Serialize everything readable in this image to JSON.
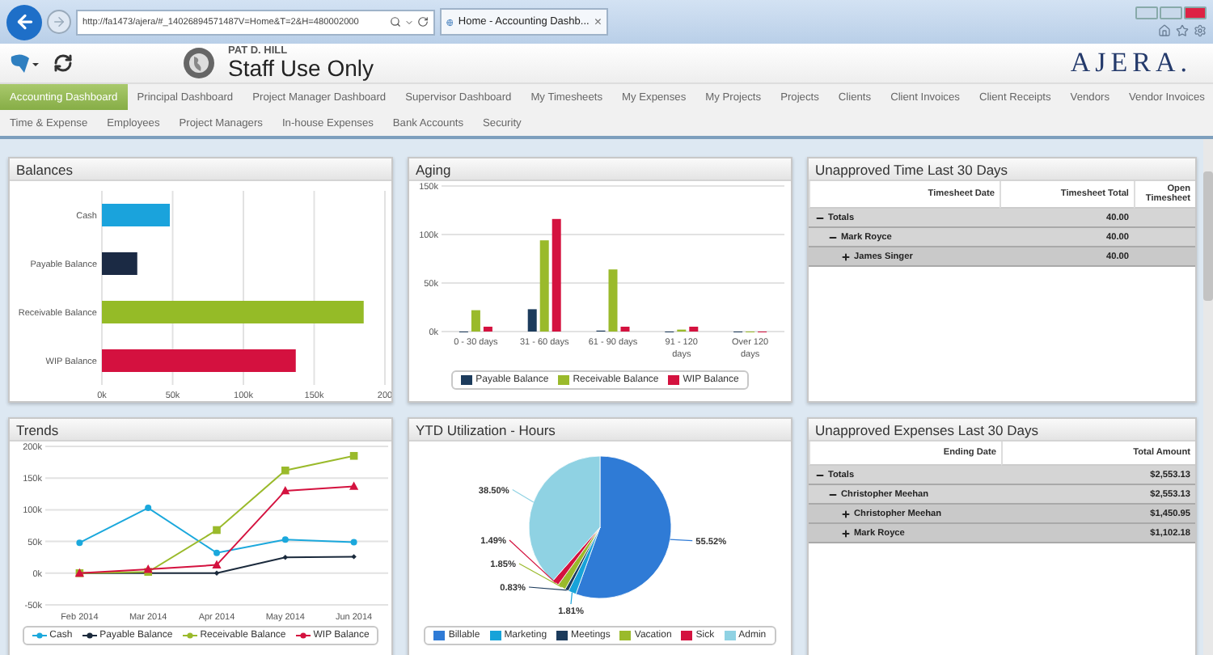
{
  "browser": {
    "address": "http://fa1473/ajera/#_14026894571487V=Home&T=2&H=480002000",
    "tab_title": "Home - Accounting Dashb...",
    "tab_close": "×"
  },
  "header": {
    "user": "PAT D. HILL",
    "title": "Staff Use Only",
    "brand": "AJERA."
  },
  "nav": [
    {
      "items": [
        {
          "label": "Accounting Dashboard",
          "selected": true
        },
        {
          "label": "Principal Dashboard",
          "selected": false
        },
        {
          "label": "Project Manager Dashboard",
          "selected": false
        },
        {
          "label": "Supervisor Dashboard",
          "selected": false
        },
        {
          "label": "My Timesheets",
          "selected": false
        },
        {
          "label": "My Expenses",
          "selected": false
        },
        {
          "label": "My Projects",
          "selected": false
        },
        {
          "label": "Projects",
          "selected": false
        },
        {
          "label": "Clients",
          "selected": false
        },
        {
          "label": "Client Invoices",
          "selected": false
        },
        {
          "label": "Client Receipts",
          "selected": false
        },
        {
          "label": "Vendors",
          "selected": false
        },
        {
          "label": "Vendor Invoices",
          "selected": false
        }
      ]
    },
    {
      "items": [
        {
          "label": "Time & Expense",
          "selected": false
        },
        {
          "label": "Employees",
          "selected": false
        },
        {
          "label": "Project Managers",
          "selected": false
        },
        {
          "label": "In-house Expenses",
          "selected": false
        },
        {
          "label": "Bank Accounts",
          "selected": false
        },
        {
          "label": "Security",
          "selected": false
        }
      ]
    }
  ],
  "balances": {
    "title": "Balances",
    "chart_data": {
      "type": "bar",
      "orientation": "horizontal",
      "categories": [
        "Cash",
        "Payable Balance",
        "Receivable Balance",
        "WIP Balance"
      ],
      "values": [
        48,
        25,
        185,
        137
      ],
      "colors": [
        "#1aa3dc",
        "#1b2a44",
        "#95bb27",
        "#d4113f"
      ],
      "grid": true,
      "xlim": [
        0,
        200
      ],
      "xticks": [
        {
          "value": 0,
          "label": "0k"
        },
        {
          "value": 50,
          "label": "50k"
        },
        {
          "value": 100,
          "label": "100k"
        },
        {
          "value": 150,
          "label": "150k"
        },
        {
          "value": 200,
          "label": "200"
        }
      ]
    }
  },
  "aging": {
    "title": "Aging",
    "chart_data": {
      "type": "bar",
      "categories": [
        "0 - 30 days",
        "31 - 60 days",
        "61 - 90 days",
        "91 - 120 days",
        "Over 120 days"
      ],
      "series": [
        {
          "name": "Payable Balance",
          "color": "#1c3b5c",
          "values": [
            0,
            23,
            1,
            0,
            0
          ]
        },
        {
          "name": "Receivable Balance",
          "color": "#9aba2b",
          "values": [
            22,
            94,
            64,
            2,
            0
          ]
        },
        {
          "name": "WIP Balance",
          "color": "#d4123f",
          "values": [
            5,
            116,
            5,
            5,
            0
          ]
        }
      ],
      "grid": true,
      "ylim": [
        0,
        150
      ],
      "yticks": [
        {
          "value": 0,
          "label": "0k"
        },
        {
          "value": 50,
          "label": "50k"
        },
        {
          "value": 100,
          "label": "100k"
        },
        {
          "value": 150,
          "label": "150k"
        }
      ]
    }
  },
  "unapproved_time": {
    "title": "Unapproved Time Last 30 Days",
    "columns": [
      "Timesheet Date",
      "Timesheet Total",
      "Open Timesheet"
    ],
    "rows": [
      {
        "label": "Totals",
        "total": "40.00",
        "expanded": true,
        "children": [
          {
            "label": "Mark Royce",
            "total": "40.00",
            "expanded": true,
            "children": [
              {
                "label": "James Singer",
                "total": "40.00",
                "expanded": false
              }
            ]
          }
        ]
      }
    ]
  },
  "trends": {
    "title": "Trends",
    "chart_data": {
      "type": "line",
      "categories": [
        "Feb 2014",
        "Mar 2014",
        "Apr 2014",
        "May 2014",
        "Jun 2014"
      ],
      "series": [
        {
          "name": "Cash",
          "color": "#1ba8dc",
          "marker": "circle",
          "values": [
            48,
            103,
            32,
            53,
            49
          ]
        },
        {
          "name": "Payable Balance",
          "color": "#1b2a3c",
          "marker": "diamond",
          "values": [
            0,
            0,
            0,
            25,
            26
          ]
        },
        {
          "name": "Receivable Balance",
          "color": "#9aba2b",
          "marker": "square",
          "values": [
            0,
            2,
            68,
            162,
            185
          ]
        },
        {
          "name": "WIP Balance",
          "color": "#d4123f",
          "marker": "triangle",
          "values": [
            0,
            6,
            13,
            130,
            137
          ]
        }
      ],
      "grid": true,
      "ylim": [
        -50,
        200
      ],
      "yticks": [
        {
          "value": -50,
          "label": "-50k"
        },
        {
          "value": 0,
          "label": "0k"
        },
        {
          "value": 50,
          "label": "50k"
        },
        {
          "value": 100,
          "label": "100k"
        },
        {
          "value": 150,
          "label": "150k"
        },
        {
          "value": 200,
          "label": "200k"
        }
      ]
    }
  },
  "ytd_utilization": {
    "title": "YTD Utilization - Hours",
    "chart_data": {
      "type": "pie",
      "categories": [
        "Billable",
        "Marketing",
        "Meetings",
        "Vacation",
        "Sick",
        "Admin"
      ],
      "values": [
        55.52,
        1.81,
        0.83,
        1.85,
        1.49,
        38.5
      ],
      "colors": [
        "#2f7bd6",
        "#17a3d9",
        "#1c3b5c",
        "#9aba2b",
        "#d4123f",
        "#8fd2e3"
      ],
      "value_labels": [
        "55.52%",
        "1.81%",
        "0.83%",
        "1.85%",
        "1.49%",
        "38.50%"
      ]
    }
  },
  "unapproved_expenses": {
    "title": "Unapproved Expenses Last 30 Days",
    "columns": [
      "Ending Date",
      "Total Amount"
    ],
    "rows": [
      {
        "label": "Totals",
        "total": "$2,553.13",
        "expanded": true,
        "children": [
          {
            "label": "Christopher Meehan",
            "total": "$2,553.13",
            "expanded": true,
            "children": [
              {
                "label": "Christopher Meehan",
                "total": "$1,450.95",
                "expanded": false
              },
              {
                "label": "Mark Royce",
                "total": "$1,102.18",
                "expanded": false
              }
            ]
          }
        ]
      }
    ]
  }
}
